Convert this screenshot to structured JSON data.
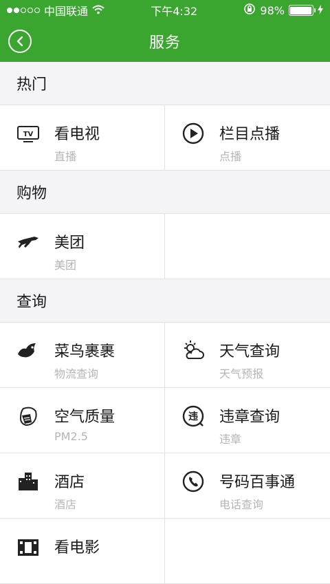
{
  "status": {
    "carrier": "中国联通",
    "time": "下午4:32",
    "battery": "98%",
    "battery_level": 0.98
  },
  "header": {
    "title": "服务"
  },
  "sections": [
    {
      "title": "热门",
      "rows": [
        [
          {
            "label": "看电视",
            "sub": "直播",
            "icon": "tv-icon"
          },
          {
            "label": "栏目点播",
            "sub": "点播",
            "icon": "play-icon"
          }
        ]
      ]
    },
    {
      "title": "购物",
      "rows": [
        [
          {
            "label": "美团",
            "sub": "美团",
            "icon": "meituan-icon"
          }
        ]
      ]
    },
    {
      "title": "查询",
      "rows": [
        [
          {
            "label": "菜鸟裹裹",
            "sub": "物流查询",
            "icon": "bird-icon"
          },
          {
            "label": "天气查询",
            "sub": "天气预报",
            "icon": "weather-icon"
          }
        ],
        [
          {
            "label": "空气质量",
            "sub": "PM2.5",
            "icon": "mask-icon"
          },
          {
            "label": "违章查询",
            "sub": "违章",
            "icon": "violation-icon"
          }
        ],
        [
          {
            "label": "酒店",
            "sub": "酒店",
            "icon": "hotel-icon"
          },
          {
            "label": "号码百事通",
            "sub": "电话查询",
            "icon": "phone-icon"
          }
        ],
        [
          {
            "label": "看电影",
            "sub": "",
            "icon": "movie-icon"
          }
        ]
      ]
    }
  ]
}
